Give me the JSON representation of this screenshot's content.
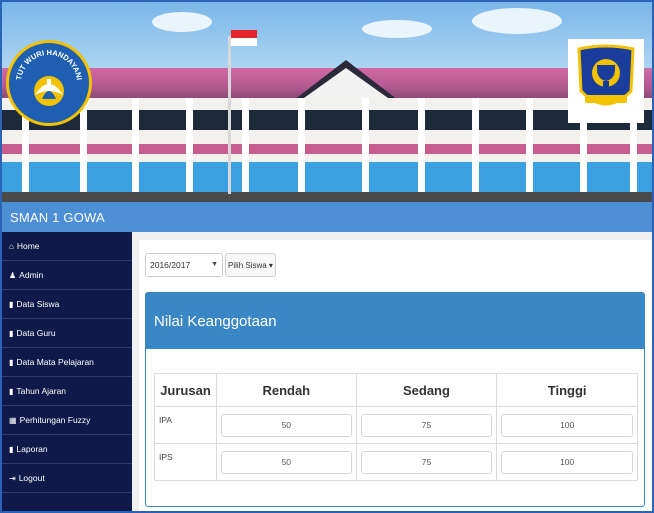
{
  "banner": {
    "left_logo_text": "TUT WURI HANDAYANI"
  },
  "site_title": "SMAN 1 GOWA",
  "sidebar": {
    "items": [
      {
        "icon": "home-icon",
        "glyph": "⌂",
        "label": "Home"
      },
      {
        "icon": "user-icon",
        "glyph": "♟",
        "label": "Admin"
      },
      {
        "icon": "book-icon",
        "glyph": "▮",
        "label": "Data Siswa"
      },
      {
        "icon": "book-icon",
        "glyph": "▮",
        "label": "Data Guru"
      },
      {
        "icon": "book-icon",
        "glyph": "▮",
        "label": "Data Mata Pelajaran"
      },
      {
        "icon": "book-icon",
        "glyph": "▮",
        "label": "Tahun Ajaran"
      },
      {
        "icon": "calculator-icon",
        "glyph": "▦",
        "label": "Perhitungan Fuzzy"
      },
      {
        "icon": "book-icon",
        "glyph": "▮",
        "label": "Laporan"
      },
      {
        "icon": "logout-icon",
        "glyph": "⇥",
        "label": "Logout"
      }
    ]
  },
  "filters": {
    "year_value": "2016/2017",
    "student_button": "Pilih Siswa ▾"
  },
  "panel": {
    "title": "Nilai Keanggotaan"
  },
  "table": {
    "headers": [
      "Jurusan",
      "Rendah",
      "Sedang",
      "Tinggi"
    ],
    "rows": [
      {
        "jurusan": "IPA",
        "rendah": "50",
        "sedang": "75",
        "tinggi": "100"
      },
      {
        "jurusan": "IPS",
        "rendah": "50",
        "sedang": "75",
        "tinggi": "100"
      }
    ]
  },
  "colors": {
    "header_blue": "#4d8fd4",
    "sidebar_navy": "#0f1a4a",
    "panel_blue": "#3a87c6"
  }
}
